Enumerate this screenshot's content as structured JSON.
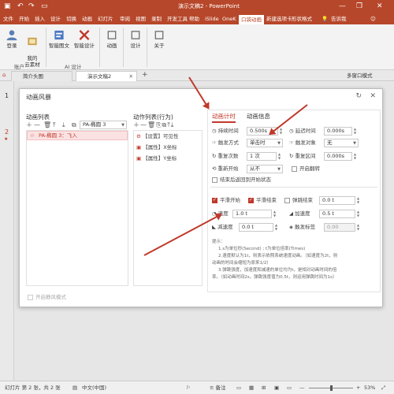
{
  "titlebar": {
    "title": "演示文稿2 - PowerPoint",
    "tell_me": "告诉我",
    "minimize": "—",
    "restore": "❐",
    "close": "✕"
  },
  "menu": [
    "文件",
    "开始",
    "插入",
    "设计",
    "切换",
    "动画",
    "幻灯片",
    "审阅",
    "视图",
    "录制",
    "开发工具",
    "帮助",
    "iSlide",
    "OneK",
    "口袋动画",
    "新建选项卡",
    "形状格式"
  ],
  "active_menu_index": 14,
  "ribbon": {
    "buttons": [
      "登录",
      "我的\n云素材",
      "智能图文",
      "智能设计",
      "动画",
      "设计",
      "关于"
    ],
    "groups": [
      "账户",
      "AI 设计"
    ]
  },
  "tabs": [
    {
      "label": "简介头图"
    },
    {
      "label": "演示文稿2"
    }
  ],
  "new_tab": "+",
  "multi_window": "多窗口模式",
  "slides": [
    {
      "num": "1"
    },
    {
      "num": "2",
      "star": "★"
    }
  ],
  "dialog": {
    "title": "动画风暴",
    "anim_list": {
      "header": "动画列表",
      "effect_select": "PA-椭圆 3",
      "selected_item": "PA-椭圆 3：飞入"
    },
    "action_list": {
      "header": "动作列表(行为)",
      "items": [
        "【设置】可见性",
        "【属性】X坐标",
        "【属性】Y坐标"
      ]
    },
    "tabs": [
      "动画计时",
      "动画信息"
    ],
    "timing": {
      "duration_label": "持续时间",
      "duration_value": "0.500s",
      "delay_label": "延迟时间",
      "delay_value": "0.000s",
      "trigger_label": "触发方式",
      "trigger_value": "单击时",
      "trigger_obj_label": "触发对象",
      "trigger_obj_value": "无",
      "repeat_label": "重复次数",
      "repeat_value": "1 次",
      "repeat_interval_label": "重复区间",
      "repeat_interval_value": "0.000s",
      "restart_label": "重新开始",
      "restart_value": "从不",
      "autoreverse_label": "开启翻转",
      "rewind_label": "结束后返回到开始状态",
      "smooth_start_label": "平滑开始",
      "smooth_end_label": "平滑结束",
      "bounce_label": "弹跳结束",
      "bounce_value": "0.0 t",
      "speed_label": "速度",
      "speed_value": "1.0 t",
      "accel_label": "加速度",
      "accel_value": "0.5 t",
      "decel_label": "减速度",
      "decel_value": "0.0 t",
      "trigger_bookmark_label": "触发标签",
      "trigger_bookmark_value": "0.00"
    },
    "tips": {
      "title": "提示：",
      "lines": [
        "1.s为单位秒(Second) ; t为单位倍率(Times)",
        "2.速度默认为1t，则表示依照系统速度动画。（如速度为2t，则",
        "动画的时间会缩短为原来1/2）",
        "3.弹跳强度，加速度和减速的单位均为t，是相对动画时间的倍",
        "率。（如动画时间2s，弹跳强度值为0.5t，则运用弹跳时间为1s）"
      ]
    },
    "silent_mode": "开启静风模式"
  },
  "status": {
    "slide": "幻灯片 第 2 张，共 2 张",
    "lang": "中文(中国)",
    "notes": "备注",
    "zoom": "53%"
  }
}
